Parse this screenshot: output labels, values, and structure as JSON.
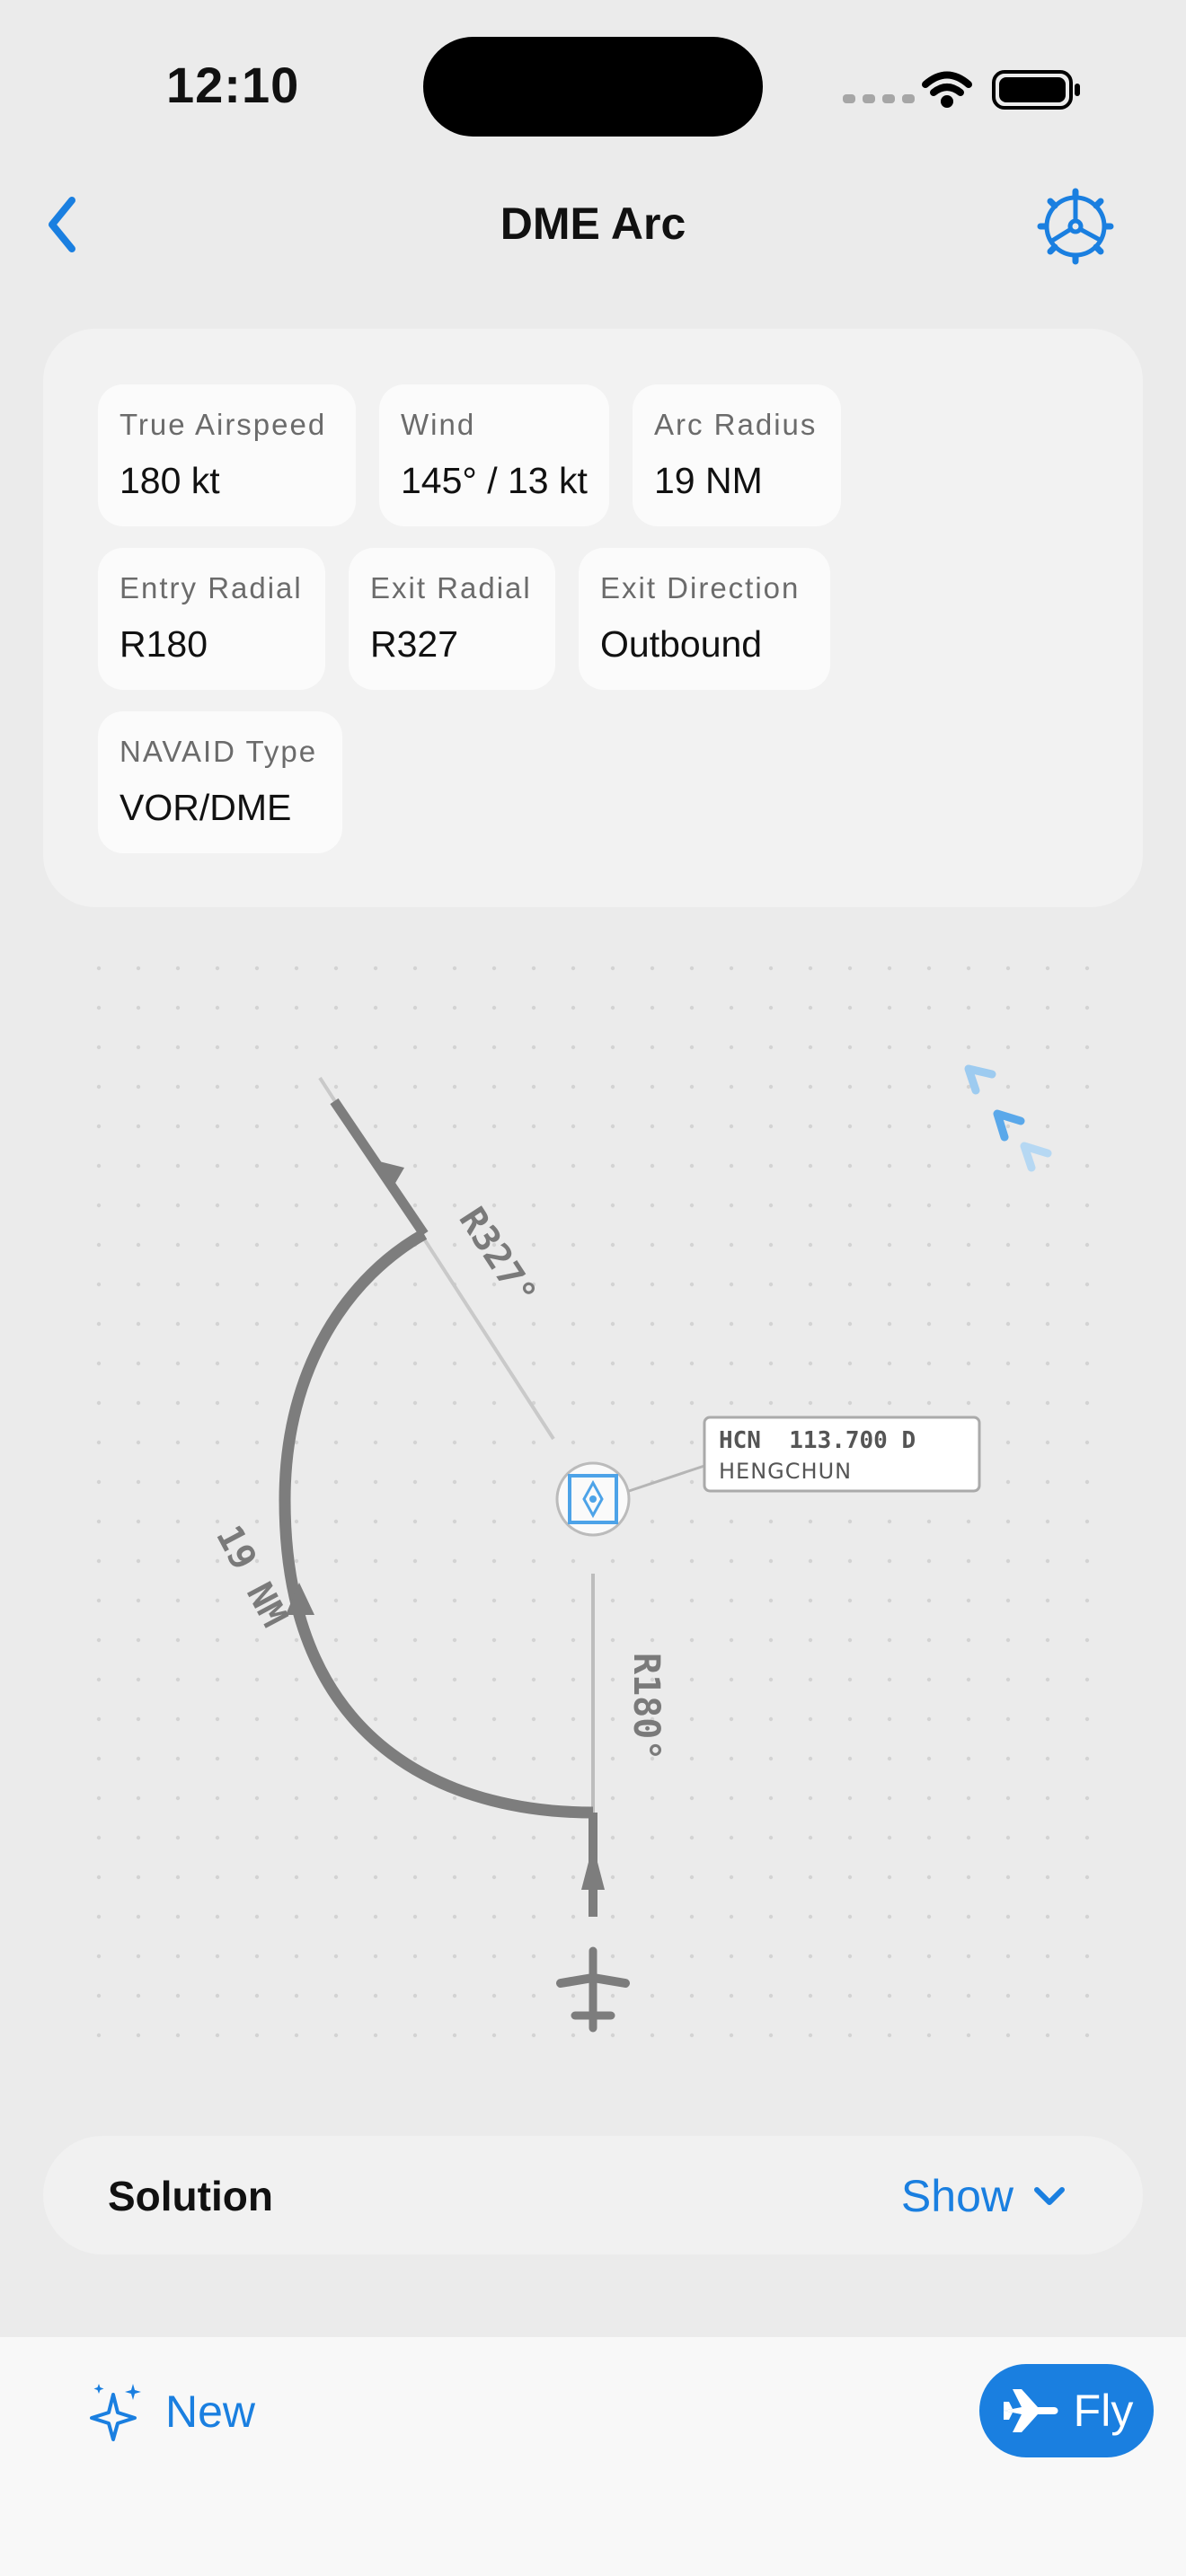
{
  "status_bar": {
    "time": "12:10"
  },
  "nav": {
    "title": "DME Arc",
    "back_icon": "chevron-left-icon",
    "settings_icon": "gear-icon"
  },
  "params": [
    {
      "label": "True Airspeed",
      "value": "180 kt"
    },
    {
      "label": "Wind",
      "value": "145° / 13 kt"
    },
    {
      "label": "Arc Radius",
      "value": "19 NM"
    },
    {
      "label": "Entry Radial",
      "value": "R180"
    },
    {
      "label": "Exit Radial",
      "value": "R327"
    },
    {
      "label": "Exit Direction",
      "value": "Outbound"
    },
    {
      "label": "NAVAID Type",
      "value": "VOR/DME"
    }
  ],
  "diagram": {
    "exit_radial_label": "R327°",
    "entry_radial_label": "R180°",
    "arc_label": "19 NM",
    "navaid": {
      "ident_freq": "HCN  113.700 D",
      "name": "HENGCHUN"
    }
  },
  "solution": {
    "label": "Solution",
    "toggle_label": "Show"
  },
  "toolbar": {
    "new_label": "New",
    "fly_label": "Fly"
  },
  "colors": {
    "accent": "#1a7fe0",
    "route": "#7d7d7d",
    "navaid": "#4da3e8"
  }
}
